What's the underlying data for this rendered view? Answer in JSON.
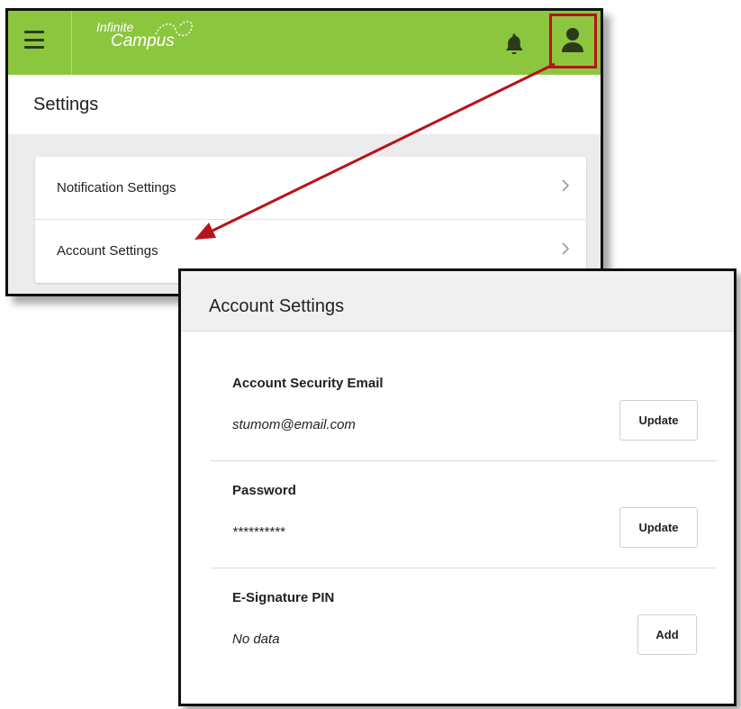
{
  "header": {
    "logo_line1": "Infinite",
    "logo_line2": "Campus"
  },
  "settings_page": {
    "title": "Settings",
    "items": [
      {
        "label": "Notification Settings"
      },
      {
        "label": "Account Settings"
      }
    ]
  },
  "account_settings": {
    "title": "Account Settings",
    "sections": [
      {
        "label": "Account Security Email",
        "value": "stumom@email.com",
        "button": "Update"
      },
      {
        "label": "Password",
        "value": "**********",
        "button": "Update"
      },
      {
        "label": "E-Signature PIN",
        "value": "No data",
        "button": "Add"
      }
    ]
  },
  "colors": {
    "topbar": "#8cc63f",
    "highlight": "#b5141a",
    "icon_dark": "#2c3a1c"
  },
  "icons": [
    "menu-icon",
    "bell-icon",
    "user-icon",
    "chevron-right-icon"
  ]
}
